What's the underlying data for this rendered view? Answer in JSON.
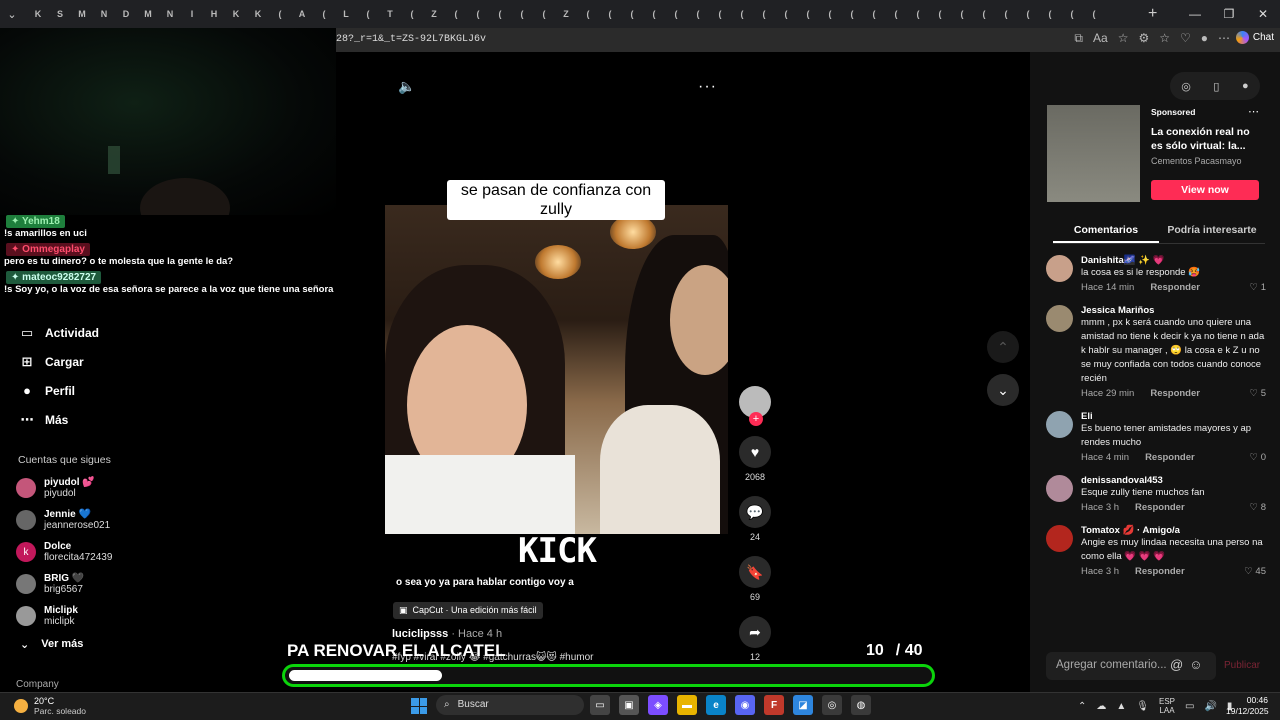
{
  "browser": {
    "tabs": [
      "K",
      "S",
      "M",
      "N",
      "D",
      "M",
      "N",
      "I",
      "H",
      "K",
      "K",
      "(",
      "A",
      "(",
      "L",
      "(",
      "T",
      "(",
      "Z",
      "(",
      "(",
      "(",
      "(",
      "(",
      "Z",
      "(",
      "(",
      "(",
      "(",
      "(",
      "(",
      "(",
      "(",
      "(",
      "(",
      "(",
      "(",
      "(",
      "(",
      "(",
      "(",
      "(",
      "(",
      "(",
      "(",
      "(",
      "(",
      "(",
      "("
    ],
    "new_tab": "+",
    "url": "28?_r=1&_t=ZS-92L7BKGLJ6v",
    "chat_label": "Chat"
  },
  "stream_chat": [
    {
      "user": "Yehm18",
      "user_color": "#1e7f3c",
      "text_color": "#9cf0b0",
      "message": "!s amarillos en uci"
    },
    {
      "user": "Ommegaplay",
      "user_color": "#5a0f1e",
      "text_color": "#ff4d6d",
      "message": "pero es tu dinero? o te molesta que la gente le da?"
    },
    {
      "user": "mateoc9282727",
      "user_color": "#1e5a3c",
      "text_color": "#cfe",
      "message": "!s Soy yo, o la voz de esa señora se parece a la voz que tiene una señora sendera?"
    }
  ],
  "sidebar": {
    "items": [
      {
        "icon": "activity-icon",
        "glyph": "▭",
        "label": "Actividad"
      },
      {
        "icon": "upload-icon",
        "glyph": "⊞",
        "label": "Cargar"
      },
      {
        "icon": "profile-icon",
        "glyph": "●",
        "label": "Perfil"
      },
      {
        "icon": "more-icon",
        "glyph": "⋯",
        "label": "Más"
      }
    ],
    "following_heading": "Cuentas que sigues",
    "accounts": [
      {
        "name": "piyudol 💕",
        "handle": "piyudol",
        "color": "#c4567a"
      },
      {
        "name": "Jennie 💙",
        "handle": "jeannerose021",
        "color": "#666"
      },
      {
        "name": "Dolce",
        "handle": "florecita472439",
        "color": "#c2185b",
        "initial": "k"
      },
      {
        "name": "BRIG 🖤",
        "handle": "brig6567",
        "color": "#777"
      },
      {
        "name": "Miclipk",
        "handle": "miclipk",
        "color": "#999"
      }
    ],
    "see_more": "Ver más",
    "footer": "Company"
  },
  "video": {
    "caption": "se pasan de confianza con zully",
    "watermark": "KICK",
    "subtitle": "o sea yo ya para hablar contigo voy a",
    "capcut": "CapCut · Una edición más fácil",
    "author": "luciclipsss",
    "posted": "· Hace 4 h",
    "hashtags": "#fyp #viral #zolly 😂 #gatchurras😺😻 #humor",
    "actions": {
      "likes": "2068",
      "comments": "24",
      "saves": "69",
      "shares": "12"
    }
  },
  "overlay": {
    "title": "PA RENOVAR EL ALCATEL",
    "current": "10",
    "total": "/ 40",
    "progress_fraction": 0.24
  },
  "ad": {
    "sponsored": "Sponsored",
    "title": "La conexión real no es sólo virtual: la...",
    "brand": "Cementos Pacasmayo",
    "cta": "View now"
  },
  "comment_tabs": [
    "Comentarios",
    "Podría interesarte"
  ],
  "comments": [
    {
      "name": "Danishita🌌 ✨ 💗",
      "text": "la cosa es si le responde 🥵",
      "time": "Hace 14 min",
      "reply": "Responder",
      "likes": "1",
      "avatar": "#c8a08a"
    },
    {
      "name": "Jessica Mariños",
      "text": "mmm , px k será cuando uno quiere una amistad no tiene k decir k ya no tiene n ada k hablr su manager , 🙄 la cosa e k Z u no se muy confiada con todos cuando conoce recién",
      "time": "Hace 29 min",
      "reply": "Responder",
      "likes": "5",
      "avatar": "#9a8a70"
    },
    {
      "name": "Eli",
      "text": "Es bueno tener amistades mayores y ap rendes mucho",
      "time": "Hace 4 min",
      "reply": "Responder",
      "likes": "0",
      "avatar": "#8fa3b0"
    },
    {
      "name": "denissandoval453",
      "text": "Esque zully tiene muchos fan",
      "time": "Hace 3 h",
      "reply": "Responder",
      "likes": "8",
      "avatar": "#b08a9a"
    },
    {
      "name": "Tomatox 💋 · Amigo/a",
      "text": "Angie es muy lindaa necesita una perso na como ella 💗 💗 💗",
      "time": "Hace 3 h",
      "reply": "Responder",
      "likes": "45",
      "avatar": "#b3261e"
    }
  ],
  "add_comment": {
    "placeholder": "Agregar comentario...",
    "publish": "Publicar"
  },
  "taskbar": {
    "temp": "20°C",
    "weather": "Parc. soleado",
    "search": "Buscar",
    "lang1": "ESP",
    "lang2": "LAA",
    "time": "00:46",
    "date": "19/12/2025"
  }
}
